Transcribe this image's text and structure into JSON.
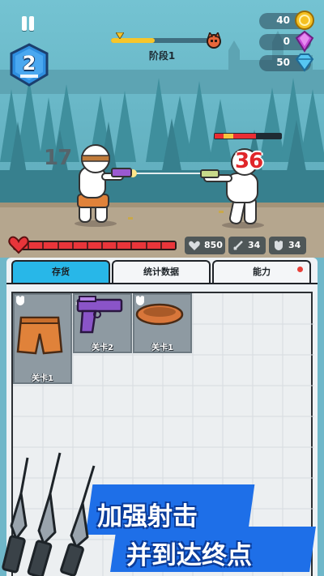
{
  "hud": {
    "level": "2",
    "stage_label": "阶段1",
    "stage_progress": 0.45,
    "currencies": [
      {
        "value": "40",
        "icon": "gold-coin-icon"
      },
      {
        "value": "0",
        "icon": "purple-gem-icon"
      },
      {
        "value": "50",
        "icon": "diamond-icon"
      }
    ]
  },
  "battle": {
    "player_label": "17",
    "enemy_label": "36",
    "enemy_health": 0.62,
    "player_health": 1.0
  },
  "stats": {
    "health": "850",
    "attack": "34",
    "armor": "34"
  },
  "tabs": {
    "inventory": "存货",
    "statistics": "统计数据",
    "ability": "能力"
  },
  "inventory": {
    "items": [
      {
        "name": "orange-shorts",
        "caption": "关卡1",
        "has_armor_badge": true
      },
      {
        "name": "purple-pistol",
        "caption": "关卡2",
        "has_attack_badge": true
      },
      {
        "name": "orange-headband",
        "caption": "关卡1",
        "has_armor_badge": true
      }
    ]
  },
  "promo": {
    "line1": "加强射击",
    "line2": "并到达终点"
  },
  "colors": {
    "active_tab": "#28b7e8",
    "promo_blue": "#1e6fe8",
    "health_red": "#e9353a"
  }
}
